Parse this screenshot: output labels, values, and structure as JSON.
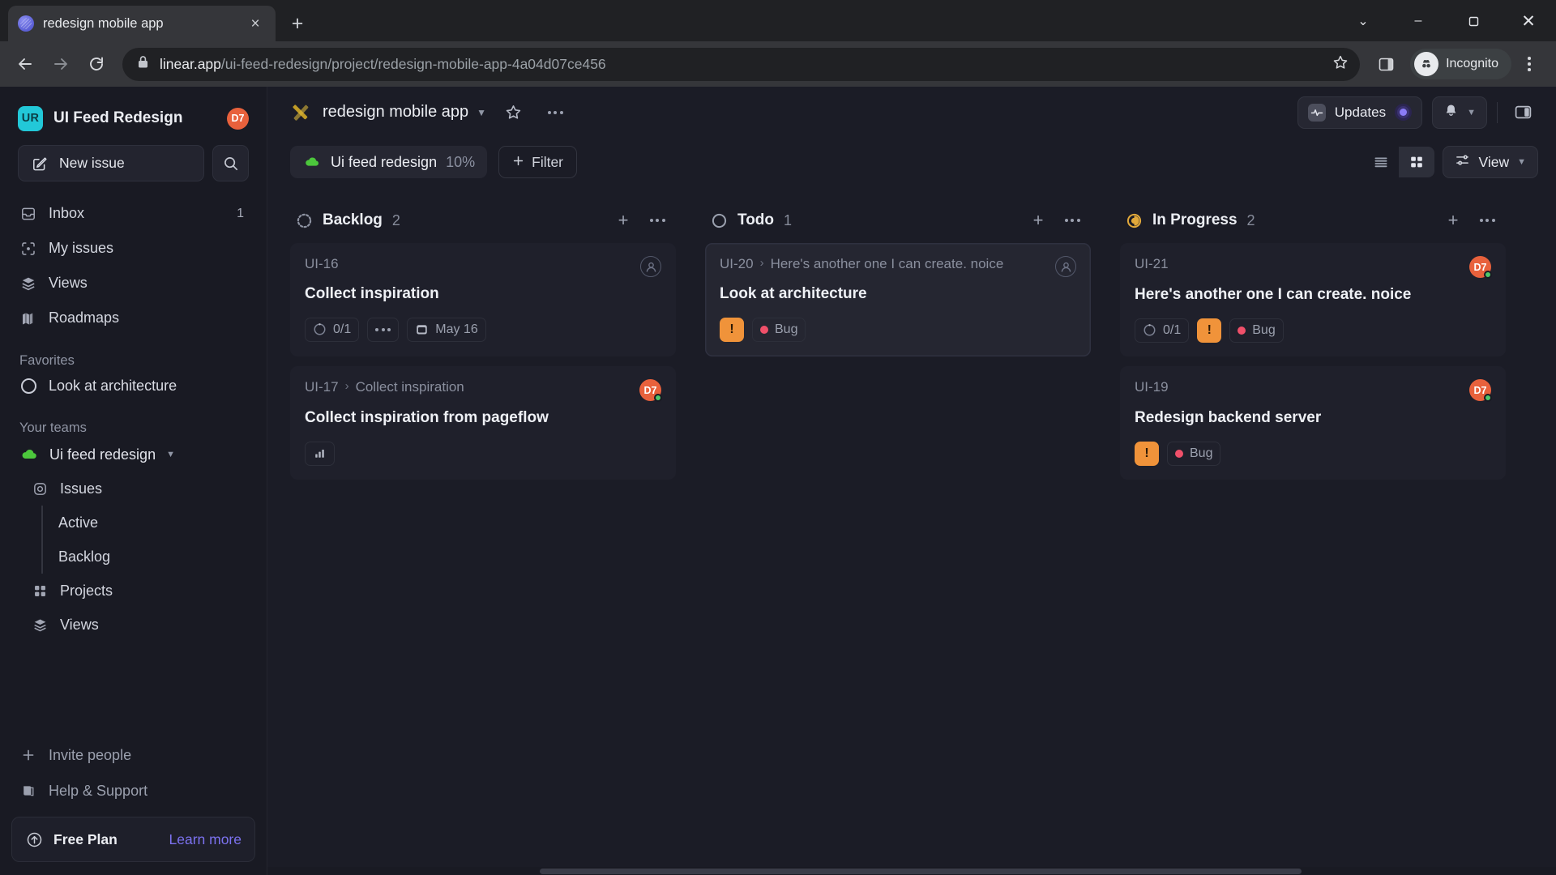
{
  "browser": {
    "tab_title": "redesign mobile app",
    "url_domain": "linear.app",
    "url_path": "/ui-feed-redesign/project/redesign-mobile-app-4a04d07ce456",
    "profile_label": "Incognito",
    "new_tab_label": "+",
    "close_tab_label": "×",
    "win_minimize": "–",
    "win_maximize": "❐",
    "win_close": "✕",
    "win_expand": "⌄"
  },
  "sidebar": {
    "workspace": {
      "badge": "UR",
      "name": "UI Feed Redesign",
      "avatar": "D7"
    },
    "new_issue_label": "New issue",
    "nav": [
      {
        "label": "Inbox",
        "icon": "inbox-icon",
        "badge": "1"
      },
      {
        "label": "My issues",
        "icon": "my-issues-icon",
        "badge": ""
      },
      {
        "label": "Views",
        "icon": "views-icon",
        "badge": ""
      },
      {
        "label": "Roadmaps",
        "icon": "roadmaps-icon",
        "badge": ""
      }
    ],
    "favorites_header": "Favorites",
    "favorites": [
      {
        "label": "Look at architecture",
        "icon": "circle-icon"
      }
    ],
    "teams_header": "Your teams",
    "team": {
      "name": "Ui feed redesign",
      "icon": "cloud-icon"
    },
    "team_nav": [
      {
        "label": "Issues",
        "icon": "issues-icon",
        "level": 1
      },
      {
        "label": "Active",
        "icon": "",
        "level": 2
      },
      {
        "label": "Backlog",
        "icon": "",
        "level": 2
      },
      {
        "label": "Projects",
        "icon": "projects-icon",
        "level": 1
      },
      {
        "label": "Views",
        "icon": "views-icon",
        "level": 1
      }
    ],
    "bottom": [
      {
        "label": "Invite people",
        "icon": "plus-icon"
      },
      {
        "label": "Help & Support",
        "icon": "book-icon"
      }
    ],
    "plan": {
      "name": "Free Plan",
      "link": "Learn more",
      "icon": "upgrade-icon"
    }
  },
  "header": {
    "project_icon": "crossed-tools-icon",
    "project_title": "redesign mobile app",
    "star_icon": "star-icon",
    "more_icon": "more-icon",
    "updates_label": "Updates",
    "panel_toggle_icon": "panel-toggle-icon",
    "bell_icon": "bell-icon"
  },
  "filter_bar": {
    "project_chip": {
      "name": "Ui feed redesign",
      "percent": "10%",
      "icon": "cloud-icon"
    },
    "filter_label": "Filter",
    "view_label": "View",
    "list_view_icon": "list-view-icon",
    "grid_view_icon": "grid-view-icon",
    "active_view": "grid"
  },
  "board": {
    "columns": [
      {
        "name": "Backlog",
        "count": "2",
        "status_icon": "backlog-dotted-circle-icon",
        "cards": [
          {
            "id": "UI-16",
            "breadcrumb": "",
            "title": "Collect inspiration",
            "avatar": "",
            "avatar_empty": true,
            "focused": false,
            "meta": [
              {
                "type": "progress",
                "label": "0/1"
              },
              {
                "type": "dots",
                "label": ""
              },
              {
                "type": "date",
                "label": "May 16"
              }
            ]
          },
          {
            "id": "UI-17",
            "breadcrumb": "Collect inspiration",
            "title": "Collect inspiration from pageflow",
            "avatar": "D7",
            "avatar_empty": false,
            "focused": false,
            "meta": [
              {
                "type": "chart",
                "label": ""
              }
            ]
          }
        ]
      },
      {
        "name": "Todo",
        "count": "1",
        "status_icon": "todo-circle-icon",
        "cards": [
          {
            "id": "UI-20",
            "breadcrumb": "Here's another one I can create. noice",
            "title": "Look at architecture",
            "avatar": "",
            "avatar_empty": true,
            "focused": true,
            "meta": [
              {
                "type": "priority",
                "label": "!"
              },
              {
                "type": "bug",
                "label": "Bug"
              }
            ]
          }
        ]
      },
      {
        "name": "In Progress",
        "count": "2",
        "status_icon": "in-progress-icon",
        "cards": [
          {
            "id": "UI-21",
            "breadcrumb": "",
            "title": "Here's another one I can create. noice",
            "avatar": "D7",
            "avatar_empty": false,
            "focused": false,
            "meta": [
              {
                "type": "progress",
                "label": "0/1"
              },
              {
                "type": "priority",
                "label": "!"
              },
              {
                "type": "bug",
                "label": "Bug"
              }
            ]
          },
          {
            "id": "UI-19",
            "breadcrumb": "",
            "title": "Redesign backend server",
            "avatar": "D7",
            "avatar_empty": false,
            "focused": false,
            "meta": [
              {
                "type": "priority",
                "label": "!"
              },
              {
                "type": "bug",
                "label": "Bug"
              }
            ]
          }
        ]
      }
    ],
    "add_icon": "plus-icon",
    "more_icon": "more-icon"
  },
  "colors": {
    "accent_purple": "#7c72f0",
    "avatar_orange": "#e8613c",
    "online_green": "#4ec76a",
    "priority_orange": "#f0933a",
    "bug_red": "#f0506a",
    "workspace_teal": "#22c8d8"
  }
}
